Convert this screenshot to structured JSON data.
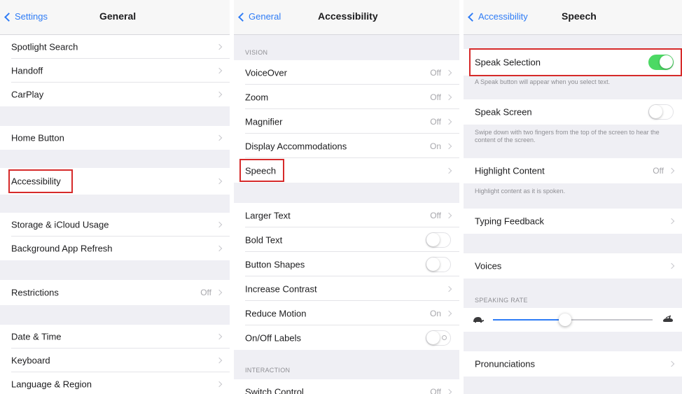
{
  "screen1": {
    "back_label": "Settings",
    "title": "General",
    "items": [
      {
        "label": "Spotlight Search"
      },
      {
        "label": "Handoff"
      },
      {
        "label": "CarPlay"
      },
      {
        "label": "Home Button"
      },
      {
        "label": "Accessibility"
      },
      {
        "label": "Storage & iCloud Usage"
      },
      {
        "label": "Background App Refresh"
      },
      {
        "label": "Restrictions",
        "value": "Off"
      },
      {
        "label": "Date & Time"
      },
      {
        "label": "Keyboard"
      },
      {
        "label": "Language & Region"
      }
    ]
  },
  "screen2": {
    "back_label": "General",
    "title": "Accessibility",
    "vision_header": "VISION",
    "interaction_header": "INTERACTION",
    "items": [
      {
        "label": "VoiceOver",
        "value": "Off"
      },
      {
        "label": "Zoom",
        "value": "Off"
      },
      {
        "label": "Magnifier",
        "value": "Off"
      },
      {
        "label": "Display Accommodations",
        "value": "On"
      },
      {
        "label": "Speech"
      },
      {
        "label": "Larger Text",
        "value": "Off"
      },
      {
        "label": "Bold Text",
        "toggle": false
      },
      {
        "label": "Button Shapes",
        "toggle": false
      },
      {
        "label": "Increase Contrast"
      },
      {
        "label": "Reduce Motion",
        "value": "On"
      },
      {
        "label": "On/Off Labels",
        "toggle": false
      },
      {
        "label": "Switch Control",
        "value": "Off"
      }
    ]
  },
  "screen3": {
    "back_label": "Accessibility",
    "title": "Speech",
    "speak_selection": {
      "label": "Speak Selection",
      "on": true,
      "footer": "A Speak button will appear when you select text."
    },
    "speak_screen": {
      "label": "Speak Screen",
      "on": false,
      "footer": "Swipe down with two fingers from the top of the screen to hear the content of the screen."
    },
    "highlight_content": {
      "label": "Highlight Content",
      "value": "Off",
      "footer": "Highlight content as it is spoken."
    },
    "typing_feedback": {
      "label": "Typing Feedback"
    },
    "voices": {
      "label": "Voices"
    },
    "speaking_rate_header": "SPEAKING RATE",
    "speaking_rate": 0.45,
    "pronunciations": {
      "label": "Pronunciations"
    }
  },
  "colors": {
    "accent": "#2f7cf6",
    "switch_on": "#4cd964",
    "highlight_box": "#d62a2a",
    "background": "#efeff4"
  },
  "icons": [
    "chevron-left-icon",
    "chevron-right-icon",
    "tortoise-icon",
    "hare-icon"
  ]
}
